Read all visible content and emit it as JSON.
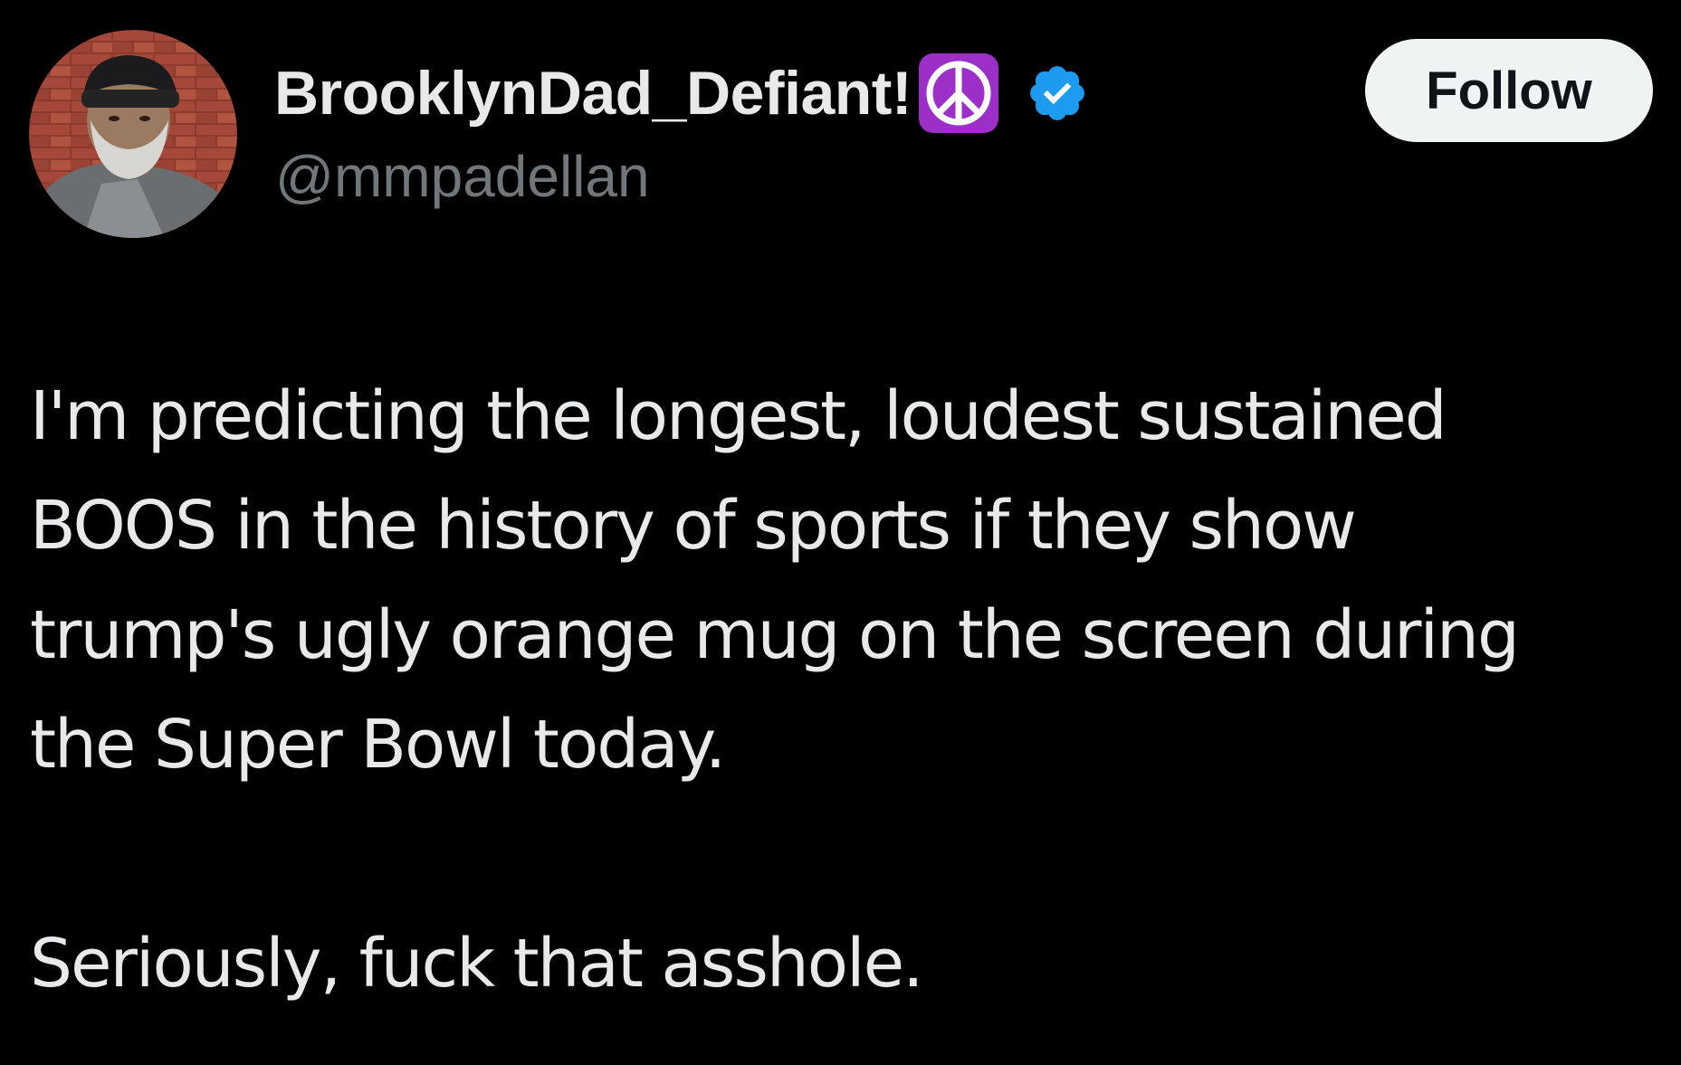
{
  "author": {
    "display_name": "BrooklynDad_Defiant!",
    "handle": "@mmpadellan",
    "name_emoji_icon": "peace-symbol-icon",
    "verified_icon": "verified-badge-icon",
    "verified_color": "#1d9bf0",
    "avatar_icon": "profile-photo"
  },
  "follow_button": {
    "label": "Follow",
    "background": "#eff3f4",
    "text_color": "#0f1419"
  },
  "tweet": {
    "paragraph1_lines": [
      "I'm predicting the longest, loudest sustained",
      "BOOS in the history of sports if they show",
      "trump's ugly orange mug on the screen during",
      "the Super Bowl today."
    ],
    "paragraph2": "Seriously, fuck that asshole."
  },
  "colors": {
    "background": "#000000",
    "text_primary": "#e7e9ea",
    "text_secondary": "#71767b",
    "emoji_purple": "#9c2fc7"
  }
}
